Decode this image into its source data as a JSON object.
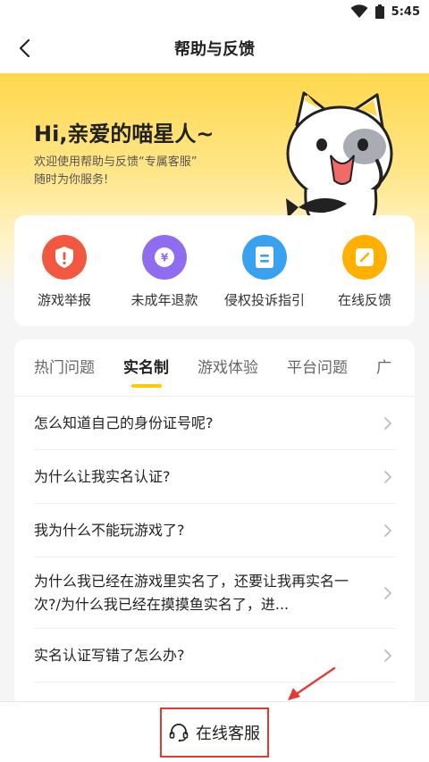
{
  "status_bar": {
    "time": "5:45"
  },
  "nav": {
    "title": "帮助与反馈"
  },
  "hero": {
    "greeting": "Hi,亲爱的喵星人~",
    "sub_line1": "欢迎使用帮助与反馈“专属客服”",
    "sub_line2": "随时为你服务!"
  },
  "quick_actions": [
    {
      "label": "游戏举报",
      "icon": "shield-alert-icon",
      "color": "#f2573f"
    },
    {
      "label": "未成年退款",
      "icon": "yuan-coin-icon",
      "color": "#8f6cf0"
    },
    {
      "label": "侵权投诉指引",
      "icon": "document-icon",
      "color": "#3aa1f0"
    },
    {
      "label": "在线反馈",
      "icon": "edit-icon",
      "color": "#ffb000"
    }
  ],
  "tabs": [
    "热门问题",
    "实名制",
    "游戏体验",
    "平台问题",
    "广"
  ],
  "active_tab": "实名制",
  "faq": [
    "怎么知道自己的身份证号呢?",
    "为什么让我实名认证?",
    "我为什么不能玩游戏了?",
    "为什么我已经在游戏里实名了，还要让我再实名一次?/为什么我已经在摸摸鱼实名了，进...",
    "实名认证写错了怎么办?"
  ],
  "bottom": {
    "service_label": "在线客服"
  },
  "colors": {
    "accent": "#ffc800",
    "annotation": "#e53935"
  }
}
